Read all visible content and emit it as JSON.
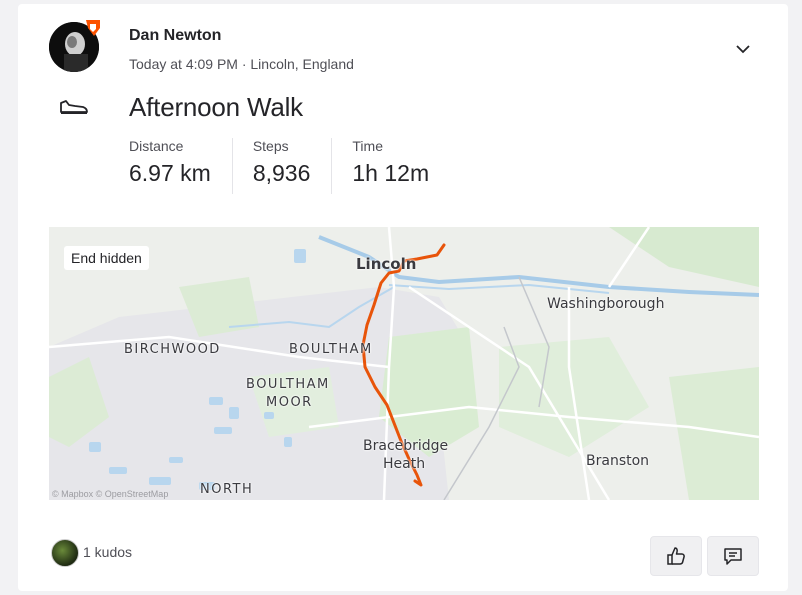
{
  "athlete": {
    "name": "Dan Newton",
    "meta": "Today at 4:09 PM · Lincoln, England"
  },
  "activity": {
    "title": "Afternoon Walk",
    "sport_icon": "shoe-icon",
    "stats": [
      {
        "label": "Distance",
        "value": "6.97 km"
      },
      {
        "label": "Steps",
        "value": "8,936"
      },
      {
        "label": "Time",
        "value": "1h 12m"
      }
    ]
  },
  "map": {
    "end_hidden_label": "End hidden",
    "route_color": "#e8540a",
    "places": [
      {
        "name": "Lincoln"
      },
      {
        "name": "Washingborough"
      },
      {
        "name": "BIRCHWOOD"
      },
      {
        "name": "BOULTHAM"
      },
      {
        "name": "BOULTHAM"
      },
      {
        "name": "MOOR"
      },
      {
        "name": "Bracebridge"
      },
      {
        "name": "Heath"
      },
      {
        "name": "Branston"
      },
      {
        "name": "NORTH"
      }
    ],
    "attribution": "© Mapbox © OpenStreetMap"
  },
  "footer": {
    "kudos": "1 kudos",
    "kudos_icon": "thumbs-up-icon",
    "comment_icon": "comment-icon"
  },
  "colors": {
    "accent": "#fc5200",
    "route": "#e8540a",
    "text": "#242428",
    "muted": "#4f4f56"
  }
}
